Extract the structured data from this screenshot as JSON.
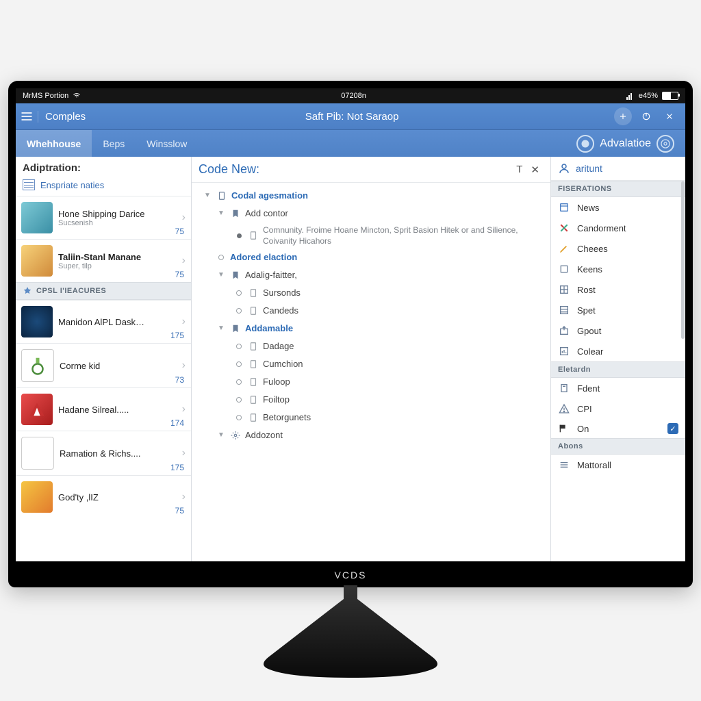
{
  "status": {
    "carrier": "MrMS Portion",
    "time": "07208n",
    "battery": "e45%"
  },
  "header": {
    "breadcrumb": "Comples",
    "title": "Saft Pib: Not Saraop"
  },
  "tabs": {
    "items": [
      "Whehhouse",
      "Beps",
      "Winsslow"
    ],
    "active_index": 0,
    "adv_label": "Advalatioe"
  },
  "left": {
    "heading": "Adiptration:",
    "subnav_label": "Enspriate naties",
    "section_a": [
      {
        "title": "Hone Shipping Darice",
        "subtitle": "Sucsenish",
        "count": "75"
      },
      {
        "title": "Taliin-Stanl Manane",
        "subtitle": "Super, tilp",
        "count": "75"
      }
    ],
    "section_header": "CPSL I'IEACURES",
    "section_b": [
      {
        "title": "Manidon AlPL Dask…",
        "count": "175"
      },
      {
        "title": "Corme kid",
        "count": "73"
      },
      {
        "title": "Hadane Silreal.....",
        "count": "174"
      },
      {
        "title": "Ramation & Richs....",
        "count": "175"
      },
      {
        "title": "God'ty ,lIZ",
        "count": "75"
      }
    ]
  },
  "mid": {
    "heading": "Code New:",
    "nodes": {
      "root": "Codal agesmation",
      "addcontor": "Add contor",
      "addcontor_desc": "Comnunity. Froime Hoane Mincton, Sprit Basion Hitek or and Silience, Coivanity Hicahors",
      "adored": "Adored elaction",
      "adalig": "Adalig-faitter,",
      "adalig_c1": "Sursonds",
      "adalig_c2": "Candeds",
      "addamable": "Addamable",
      "add_c1": "Dadage",
      "add_c2": "Cumchion",
      "add_c3": "Fuloop",
      "add_c4": "Foiltop",
      "add_c5": "Betorgunets",
      "addozont": "Addozont"
    }
  },
  "right": {
    "search_label": "aritunt",
    "section1": "FISERATIONS",
    "items1": [
      "News",
      "Candorment",
      "Cheees",
      "Keens",
      "Rost",
      "Spet",
      "Gpout",
      "Colear"
    ],
    "section2": "Eletardn",
    "items2": [
      "Fdent",
      "CPI"
    ],
    "toggle_label": "On",
    "section3": "Abons",
    "items3": [
      "Mattorall"
    ]
  },
  "brand": "VCDS"
}
